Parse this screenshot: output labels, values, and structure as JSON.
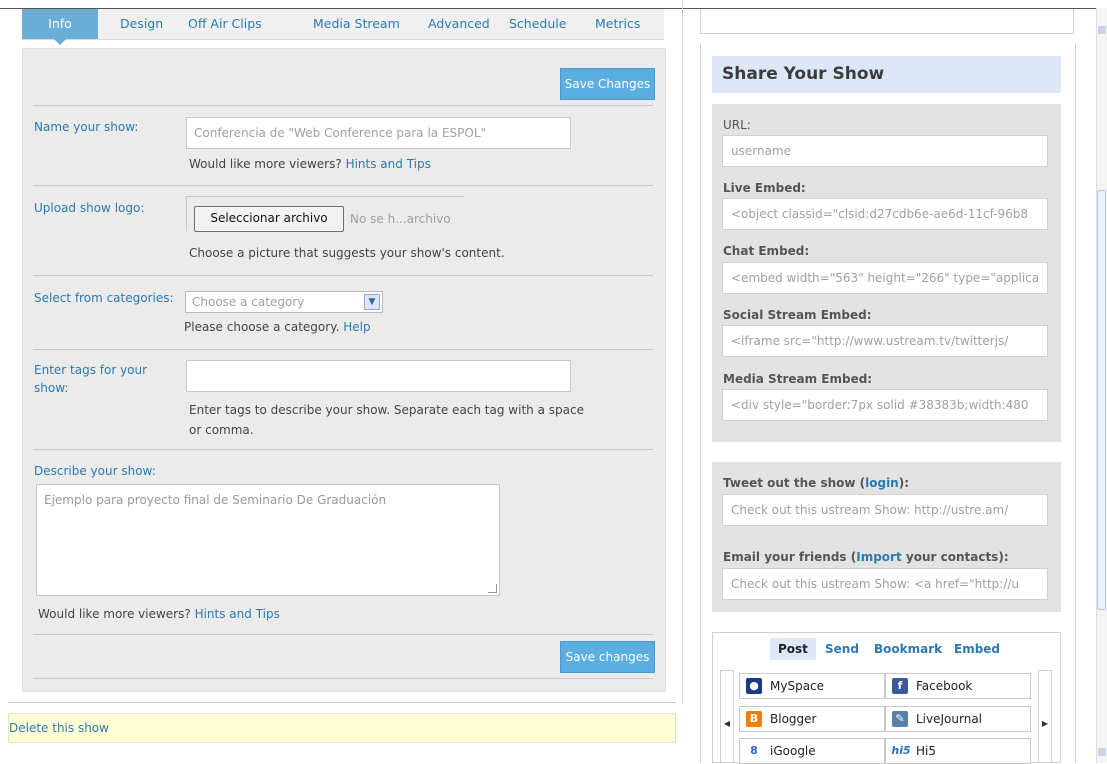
{
  "tabs": [
    "Info",
    "Design",
    "Off Air Clips",
    "Media Stream",
    "Advanced",
    "Schedule",
    "Metrics"
  ],
  "form": {
    "save_changes_top": "Save Changes",
    "save_changes_bottom": "Save changes",
    "name_label": "Name your show:",
    "name_value": "Conferencia de \"Web Conference para la ESPOL\"",
    "name_help_prefix": "Would like more viewers?",
    "hints_link": "Hints and Tips",
    "logo_label": "Upload show logo:",
    "file_button": "Seleccionar archivo",
    "file_status": "No se h...archivo",
    "logo_help": "Choose a picture that suggests your show's content.",
    "category_label": "Select from categories:",
    "category_value": "Choose a category",
    "category_help_prefix": "Please choose a category.",
    "help_link": "Help",
    "tags_label": "Enter tags for your show:",
    "tags_value": "",
    "tags_help": "Enter tags to describe your show. Separate each tag with a space or comma.",
    "describe_label": "Describe your show:",
    "describe_value": "Ejemplo para proyecto final de Seminario De Graduación",
    "describe_help_prefix": "Would like more viewers?",
    "describe_hints_link": "Hints and Tips"
  },
  "delete_link": "Delete this show",
  "share": {
    "title": "Share Your Show",
    "url_label": "URL:",
    "url_value": "username",
    "live_label": "Live Embed:",
    "live_value": "<object classid=\"clsid:d27cdb6e-ae6d-11cf-96b8",
    "chat_label": "Chat Embed:",
    "chat_value": "<embed width=\"563\" height=\"266\" type=\"applica",
    "social_label": "Social Stream Embed:",
    "social_value": "<iframe src=\"http://www.ustream.tv/twitterjs/",
    "media_label": "Media Stream Embed:",
    "media_value": "<div style=\"border:7px solid #38383b;width:480",
    "tweet_prefix": "Tweet out the show (",
    "tweet_link": "login",
    "tweet_suffix": "):",
    "tweet_value": "Check out this ustream Show: http://ustre.am/",
    "email_prefix": "Email your friends (",
    "email_link": "Import",
    "email_suffix": " your contacts):",
    "email_value": "Check out this ustream Show: <a href=\"http://u",
    "tabs": [
      "Post",
      "Send",
      "Bookmark",
      "Embed"
    ],
    "services": [
      "MySpace",
      "Facebook",
      "Blogger",
      "LiveJournal",
      "iGoogle",
      "Hi5"
    ],
    "service_icons": {
      "MySpace": "myspace-icon",
      "Facebook": "facebook-icon",
      "Blogger": "blogger-icon",
      "LiveJournal": "livejournal-icon",
      "iGoogle": "igoogle-icon",
      "Hi5": "hi5-icon"
    }
  }
}
